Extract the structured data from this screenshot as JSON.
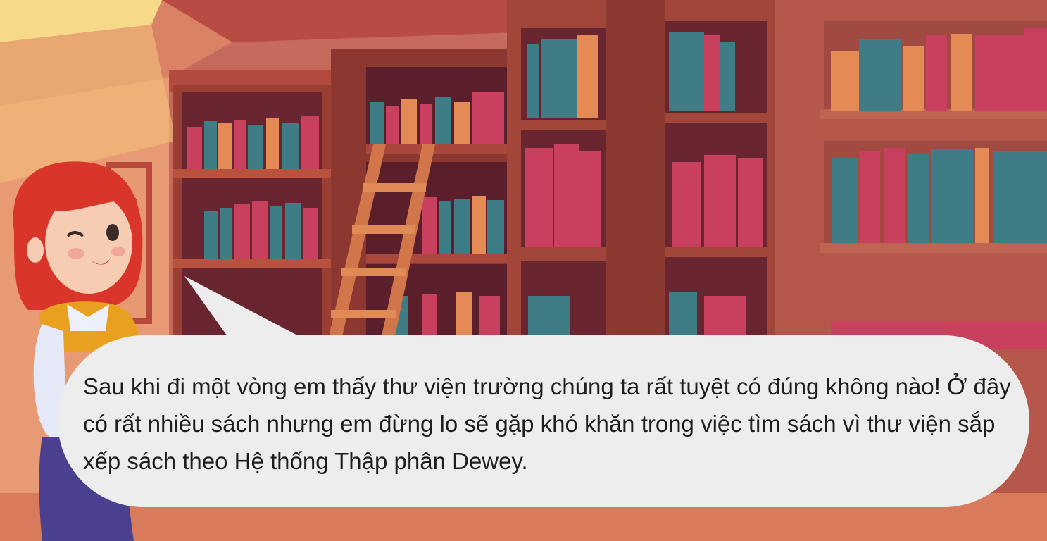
{
  "colors": {
    "wall": "#c86a5c",
    "shelf_wood": "#a8473a",
    "shelf_dark": "#5a1f2a",
    "book_teal": "#3f7d86",
    "book_pink": "#c9405e",
    "book_orange": "#e38a55",
    "bubble": "#ededed",
    "text": "#1e1e1e",
    "hair": "#d9352b"
  },
  "icons": {
    "character": "librarian-girl-winking-icon",
    "ladder": "library-ladder-icon",
    "window": "sunlit-window-icon"
  },
  "dialog": {
    "text": "Sau khi đi một vòng em thấy thư viện trường chúng ta rất tuyệt có đúng không nào! Ở đây có rất nhiều sách nhưng em đừng lo sẽ gặp khó khăn trong việc tìm sách vì thư viện sắp xếp sách theo Hệ thống Thập phân Dewey."
  }
}
